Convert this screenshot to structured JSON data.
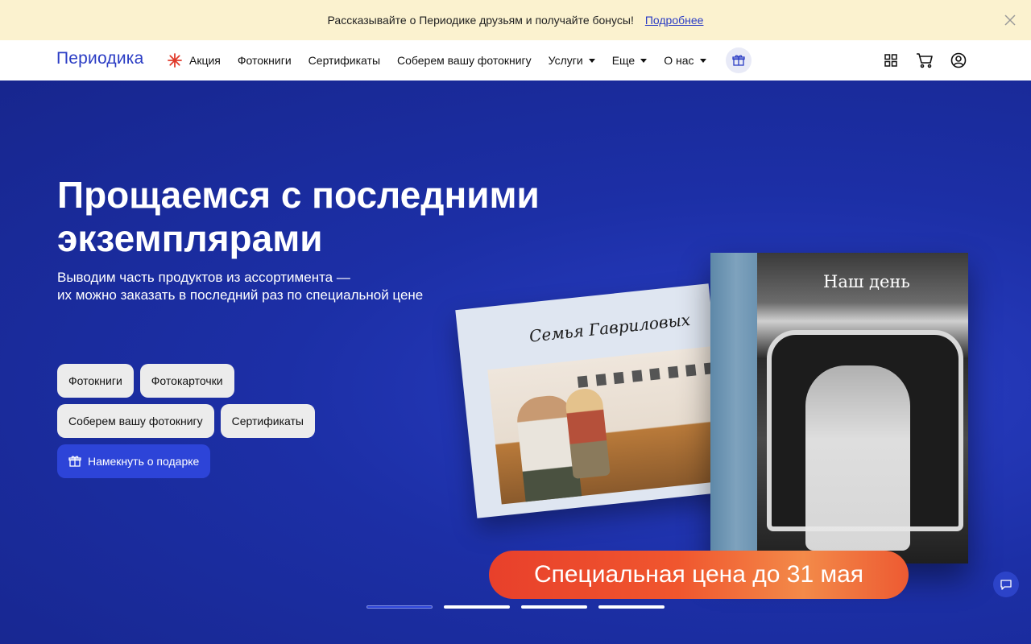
{
  "promo": {
    "text": "Рассказывайте о Периодике друзьям и получайте бонусы!",
    "link": "Подробнее"
  },
  "header": {
    "logo": "Периодика",
    "nav": [
      {
        "label": "Акция"
      },
      {
        "label": "Фотокниги"
      },
      {
        "label": "Сертификаты"
      },
      {
        "label": "Соберем вашу фотокнигу"
      },
      {
        "label": "Услуги"
      },
      {
        "label": "Еще"
      },
      {
        "label": "О нас"
      }
    ]
  },
  "hero": {
    "title": "Прощаемся с последними экземплярами",
    "subtitle_line1": "Выводим часть продуктов из ассортимента —",
    "subtitle_line2": "их можно заказать в последний раз по специальной цене",
    "chips": [
      "Фотокниги",
      "Фотокарточки",
      "Соберем вашу фотокнигу",
      "Сертификаты"
    ],
    "hint_button": "Намекнуть о подарке",
    "book_left_signature": "Семья Гавриловых",
    "book_right_title": "Наш день",
    "banner": "Специальная цена до 31 мая"
  },
  "carousel": {
    "total": 4,
    "active": 1
  },
  "colors": {
    "brand": "#2a3cc4",
    "hero_bg": "#1c2fa6",
    "promo_bg": "#fbf2cf",
    "accent_orange": "#f0562e",
    "chip_bg": "#ececec"
  }
}
